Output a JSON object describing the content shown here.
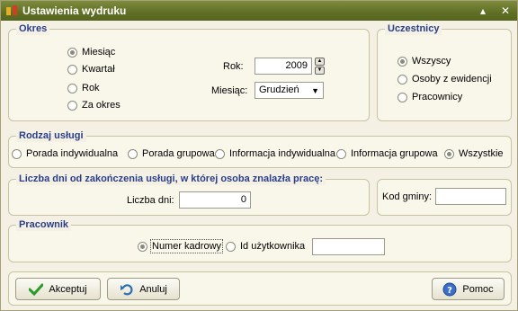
{
  "window": {
    "title": "Ustawienia wydruku",
    "minimize_glyph": "▴",
    "close_glyph": "✕"
  },
  "okres": {
    "title": "Okres",
    "options": [
      "Miesiąc",
      "Kwartał",
      "Rok",
      "Za okres"
    ],
    "selected": "Miesiąc",
    "rok_label": "Rok:",
    "rok_value": "2009",
    "miesiac_label": "Miesiąc:",
    "miesiac_value": "Grudzień"
  },
  "uczestnicy": {
    "title": "Uczestnicy",
    "options": [
      "Wszyscy",
      "Osoby z ewidencji",
      "Pracownicy"
    ],
    "selected": "Wszyscy"
  },
  "rodzaj": {
    "title": "Rodzaj usługi",
    "options": [
      "Porada indywidualna",
      "Porada grupowa",
      "Informacja indywidualna",
      "Informacja grupowa",
      "Wszystkie"
    ],
    "selected": "Wszystkie"
  },
  "liczba": {
    "title": "Liczba dni od zakończenia usługi, w której osoba znalazła pracę:",
    "label": "Liczba dni:",
    "value": "0"
  },
  "kod_gminy": {
    "label": "Kod gminy:",
    "value": ""
  },
  "pracownik": {
    "title": "Pracownik",
    "options": [
      "Numer kadrowy",
      "Id użytkownika"
    ],
    "selected": "Numer kadrowy",
    "value": ""
  },
  "buttons": {
    "ok": "Akceptuj",
    "cancel": "Anuluj",
    "help": "Pomoc"
  },
  "colors": {
    "titlebar": "#5f6f24",
    "group_title": "#2a3e8a"
  }
}
